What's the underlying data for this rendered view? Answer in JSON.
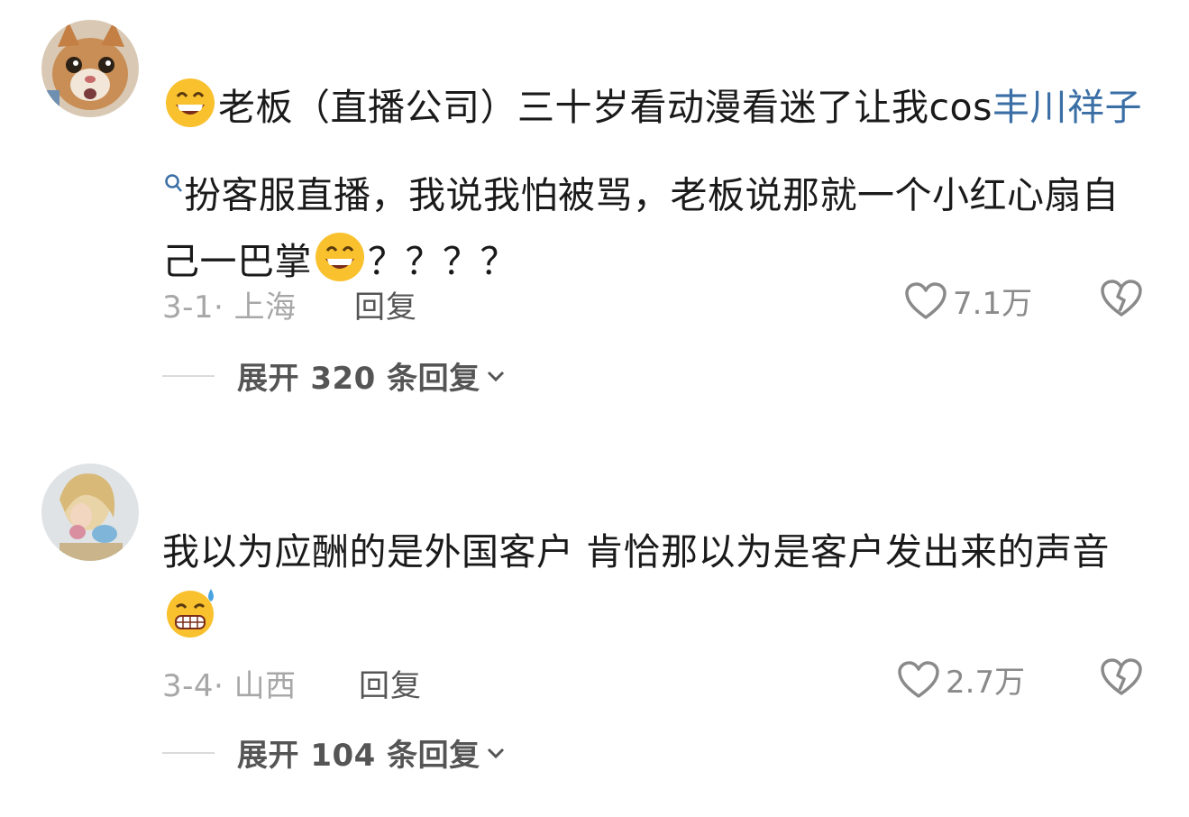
{
  "comments": [
    {
      "text_parts": {
        "before": "老板（直播公司）三十岁看动漫看迷了让我cos",
        "link": "丰川祥子",
        "after": "扮客服直播，我说我怕被骂，老板说那就一个小红心扇自己一巴掌",
        "end": "？？？？"
      },
      "date": "3-1",
      "location": "上海",
      "reply_label": "回复",
      "likes": "7.1万",
      "expand_label": "展开 320 条回复"
    },
    {
      "text_parts": {
        "before": "我以为应酬的是外国客户 肯恰那以为是客户发出来的声音"
      },
      "date": "3-4",
      "location": "山西",
      "reply_label": "回复",
      "likes": "2.7万",
      "expand_label": "展开 104 条回复"
    }
  ],
  "icons": {
    "avatar_1": "cat-avatar",
    "avatar_2": "person-avatar",
    "emoji_grin": "grinning-emoji",
    "emoji_sweat": "grin-sweat-emoji",
    "search_hint": "search-icon",
    "like": "heart-outline-icon",
    "dislike": "broken-heart-icon",
    "expand": "chevron-down-icon"
  },
  "colors": {
    "link": "#3a6ea5",
    "meta": "#a7a7a7",
    "action": "#555555"
  }
}
